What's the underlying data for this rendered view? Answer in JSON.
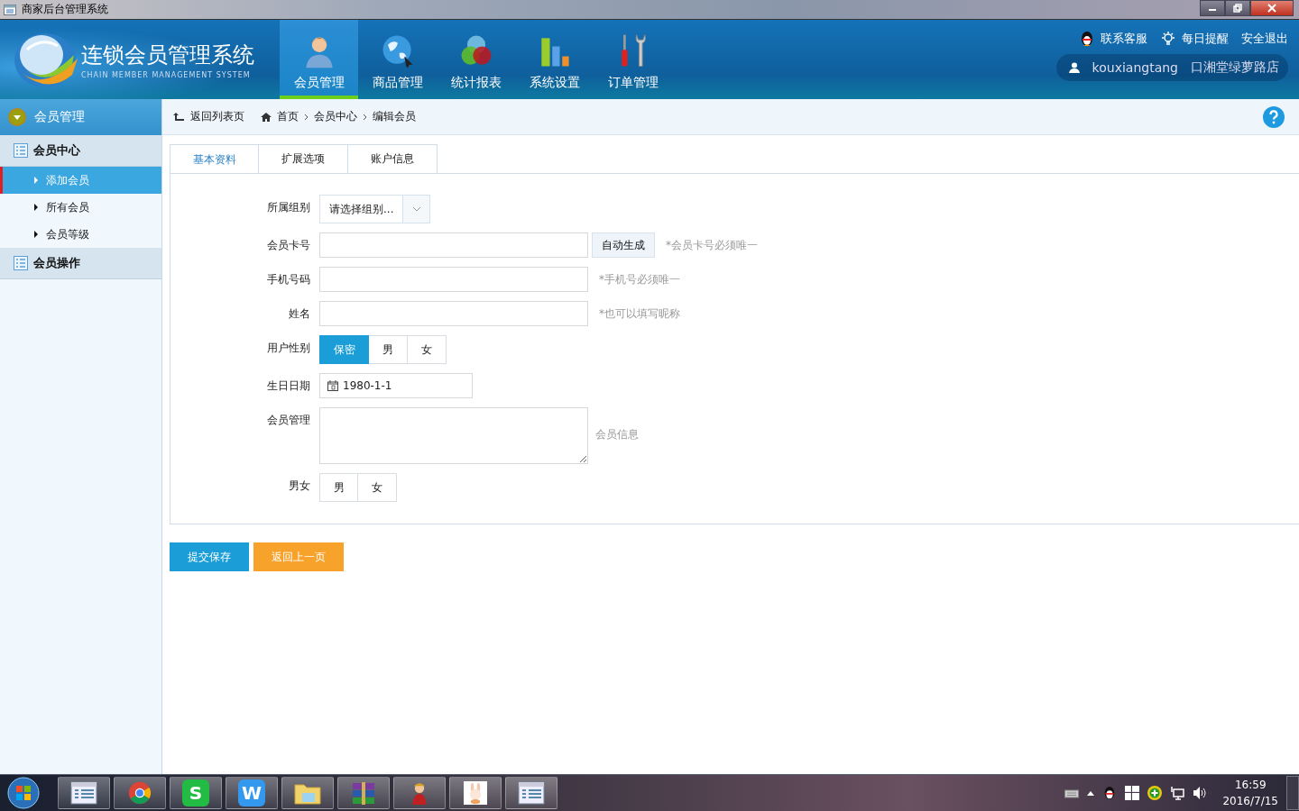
{
  "window": {
    "title": "商家后台管理系统"
  },
  "header": {
    "logo_title": "连锁会员管理系统",
    "logo_subtitle": "CHAIN MEMBER MANAGEMENT SYSTEM",
    "nav": [
      {
        "label": "会员管理",
        "selected": true
      },
      {
        "label": "商品管理",
        "selected": false
      },
      {
        "label": "统计报表",
        "selected": false
      },
      {
        "label": "系统设置",
        "selected": false
      },
      {
        "label": "订单管理",
        "selected": false
      }
    ],
    "links": [
      "联系客服",
      "每日提醒",
      "安全退出"
    ],
    "user": {
      "name": "kouxiangtang",
      "store": "口湘堂绿萝路店"
    }
  },
  "sidebar": {
    "title": "会员管理",
    "groups": [
      {
        "label": "会员中心",
        "children": [
          {
            "label": "添加会员",
            "selected": true
          },
          {
            "label": "所有会员",
            "selected": false
          },
          {
            "label": "会员等级",
            "selected": false
          }
        ]
      },
      {
        "label": "会员操作"
      }
    ]
  },
  "breadcrumb": {
    "back": "返回列表页",
    "items": [
      "首页",
      "会员中心",
      "编辑会员"
    ]
  },
  "tabs": [
    {
      "label": "基本资料",
      "selected": true
    },
    {
      "label": "扩展选项",
      "selected": false
    },
    {
      "label": "账户信息",
      "selected": false
    }
  ],
  "form": [
    {
      "kind": "select",
      "label": "所属组别",
      "value": "请选择组别..."
    },
    {
      "kind": "text",
      "label": "会员卡号",
      "button": "自动生成",
      "hint": "*会员卡号必须唯一"
    },
    {
      "kind": "text",
      "label": "手机号码",
      "hint": "*手机号必须唯一"
    },
    {
      "kind": "text",
      "label": "姓名",
      "hint": "*也可以填写昵称"
    },
    {
      "kind": "segmented",
      "label": "用户性别",
      "options": [
        {
          "label": "保密",
          "selected": true
        },
        {
          "label": "男",
          "selected": false
        },
        {
          "label": "女",
          "selected": false
        }
      ]
    },
    {
      "kind": "date",
      "label": "生日日期",
      "value": "1980-1-1"
    },
    {
      "kind": "textarea",
      "label": "会员管理",
      "hint": "会员信息"
    },
    {
      "kind": "segmented",
      "label": "男女",
      "options": [
        {
          "label": "男",
          "selected": false
        },
        {
          "label": "女",
          "selected": false
        }
      ]
    }
  ],
  "buttons": [
    {
      "label": "提交保存",
      "kind": "primary"
    },
    {
      "label": "返回上一页",
      "kind": "secondary"
    }
  ],
  "taskbar": {
    "apps": [
      {
        "kind": "window"
      },
      {
        "kind": "browser"
      },
      {
        "kind": "letter",
        "glyph": "S",
        "color": "#22bb44"
      },
      {
        "kind": "letter",
        "glyph": "W",
        "color": "#3399ee"
      },
      {
        "kind": "folder"
      },
      {
        "kind": "archive"
      },
      {
        "kind": "figure"
      },
      {
        "kind": "picture"
      },
      {
        "kind": "window"
      }
    ],
    "time": "16:59",
    "date": "2016/7/15"
  }
}
